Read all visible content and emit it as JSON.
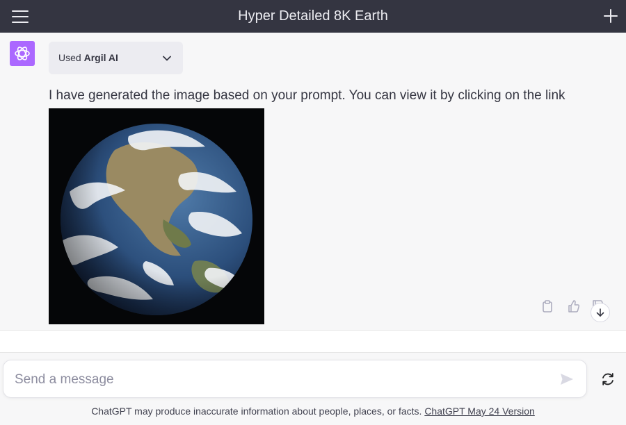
{
  "header": {
    "title": "Hyper Detailed 8K Earth"
  },
  "message": {
    "plugin_used_prefix": "Used",
    "plugin_name": "Argil AI",
    "text": "I have generated the image based on your prompt. You can view it by clicking on the link"
  },
  "composer": {
    "placeholder": "Send a message"
  },
  "footer": {
    "disclaimer": "ChatGPT may produce inaccurate information about people, places, or facts.",
    "version_link": "ChatGPT May 24 Version"
  },
  "colors": {
    "header_bg": "#343541",
    "assistant_avatar": "#ab68ff",
    "page_bg": "#f7f7f8"
  },
  "icons": [
    "menu-icon",
    "plus-icon",
    "openai-logo-icon",
    "chevron-down-icon",
    "clipboard-icon",
    "thumbs-up-icon",
    "thumbs-down-icon",
    "arrow-down-icon",
    "send-icon",
    "regenerate-icon"
  ]
}
